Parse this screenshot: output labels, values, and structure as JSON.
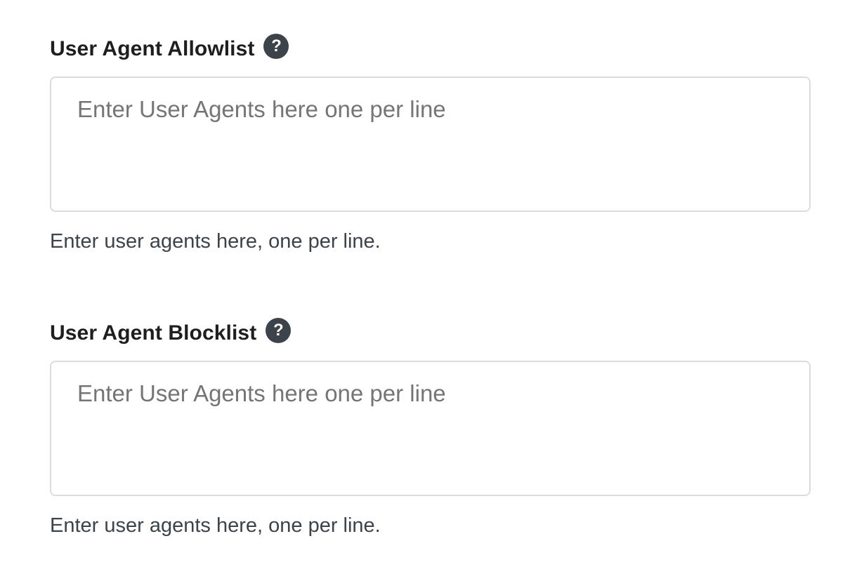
{
  "allowlist": {
    "label": "User Agent Allowlist",
    "help_icon": "?",
    "placeholder": "Enter User Agents here one per line",
    "value": "",
    "description": "Enter user agents here, one per line."
  },
  "blocklist": {
    "label": "User Agent Blocklist",
    "help_icon": "?",
    "placeholder": "Enter User Agents here one per line",
    "value": "",
    "description": "Enter user agents here, one per line."
  },
  "icons": {
    "help": "help-question-icon"
  },
  "colors": {
    "help_icon_bg": "#3c434a",
    "placeholder": "#757575",
    "border": "#dcdcde"
  }
}
